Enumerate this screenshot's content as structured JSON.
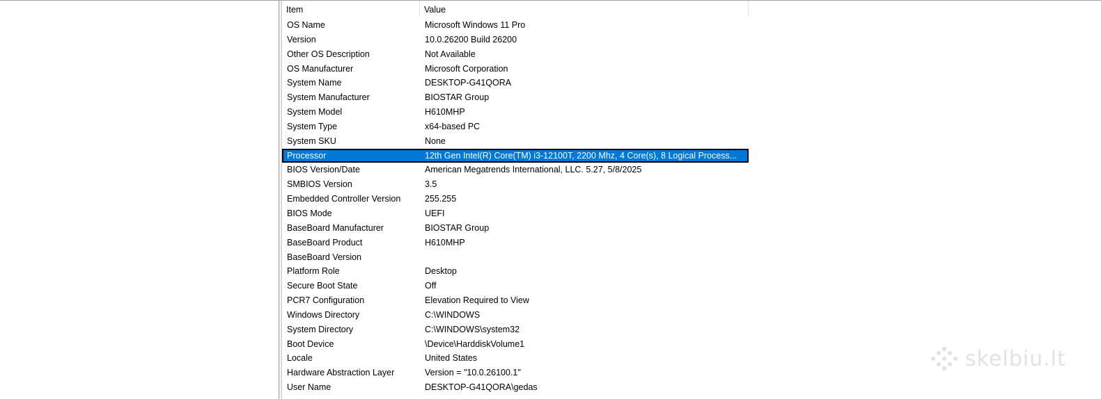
{
  "columns": {
    "item": "Item",
    "value": "Value"
  },
  "rows": [
    {
      "item": "OS Name",
      "value": "Microsoft Windows 11 Pro"
    },
    {
      "item": "Version",
      "value": "10.0.26200 Build 26200"
    },
    {
      "item": "Other OS Description",
      "value": "Not Available"
    },
    {
      "item": "OS Manufacturer",
      "value": "Microsoft Corporation"
    },
    {
      "item": "System Name",
      "value": "DESKTOP-G41QORA"
    },
    {
      "item": "System Manufacturer",
      "value": "BIOSTAR Group"
    },
    {
      "item": "System Model",
      "value": "H610MHP"
    },
    {
      "item": "System Type",
      "value": "x64-based PC"
    },
    {
      "item": "System SKU",
      "value": "None"
    },
    {
      "item": "Processor",
      "value": "12th Gen Intel(R) Core(TM) i3-12100T, 2200 Mhz, 4 Core(s), 8 Logical Process..."
    },
    {
      "item": "BIOS Version/Date",
      "value": "American Megatrends International, LLC. 5.27, 5/8/2025"
    },
    {
      "item": "SMBIOS Version",
      "value": "3.5"
    },
    {
      "item": "Embedded Controller Version",
      "value": "255.255"
    },
    {
      "item": "BIOS Mode",
      "value": "UEFI"
    },
    {
      "item": "BaseBoard Manufacturer",
      "value": "BIOSTAR Group"
    },
    {
      "item": "BaseBoard Product",
      "value": "H610MHP"
    },
    {
      "item": "BaseBoard Version",
      "value": ""
    },
    {
      "item": "Platform Role",
      "value": "Desktop"
    },
    {
      "item": "Secure Boot State",
      "value": "Off"
    },
    {
      "item": "PCR7 Configuration",
      "value": "Elevation Required to View"
    },
    {
      "item": "Windows Directory",
      "value": "C:\\WINDOWS"
    },
    {
      "item": "System Directory",
      "value": "C:\\WINDOWS\\system32"
    },
    {
      "item": "Boot Device",
      "value": "\\Device\\HarddiskVolume1"
    },
    {
      "item": "Locale",
      "value": "United States"
    },
    {
      "item": "Hardware Abstraction Layer",
      "value": "Version = \"10.0.26100.1\""
    },
    {
      "item": "User Name",
      "value": "DESKTOP-G41QORA\\gedas"
    }
  ],
  "selected_row": "Processor",
  "watermark": {
    "text": "skelbiu.lt",
    "icon": "dots-logo-icon"
  },
  "colors": {
    "selection": "#0078d7",
    "watermark": "#dfe3e8"
  }
}
